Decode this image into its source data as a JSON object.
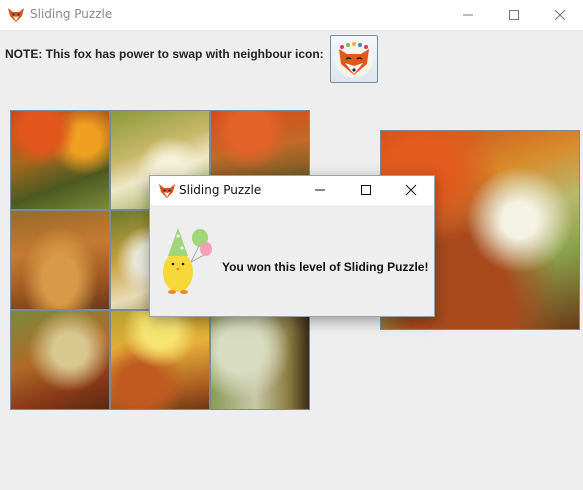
{
  "window": {
    "title": "Sliding Puzzle",
    "icon": "fox-icon"
  },
  "note": {
    "text": "NOTE: This fox has power to swap with neighbour icon:"
  },
  "fox_button": {
    "icon": "fox-icon"
  },
  "puzzle": {
    "rows": 3,
    "columns": 3,
    "image": "autumn forest path"
  },
  "preview": {
    "image": "autumn forest path"
  },
  "dialog": {
    "title": "Sliding Puzzle",
    "icon": "chick-balloons-icon",
    "message": "You won this level of Sliding Puzzle!"
  },
  "colors": {
    "background": "#eeeeee",
    "titlebar": "#ffffff",
    "fox_orange": "#e0581c",
    "grid_border": "#7a8a99"
  }
}
